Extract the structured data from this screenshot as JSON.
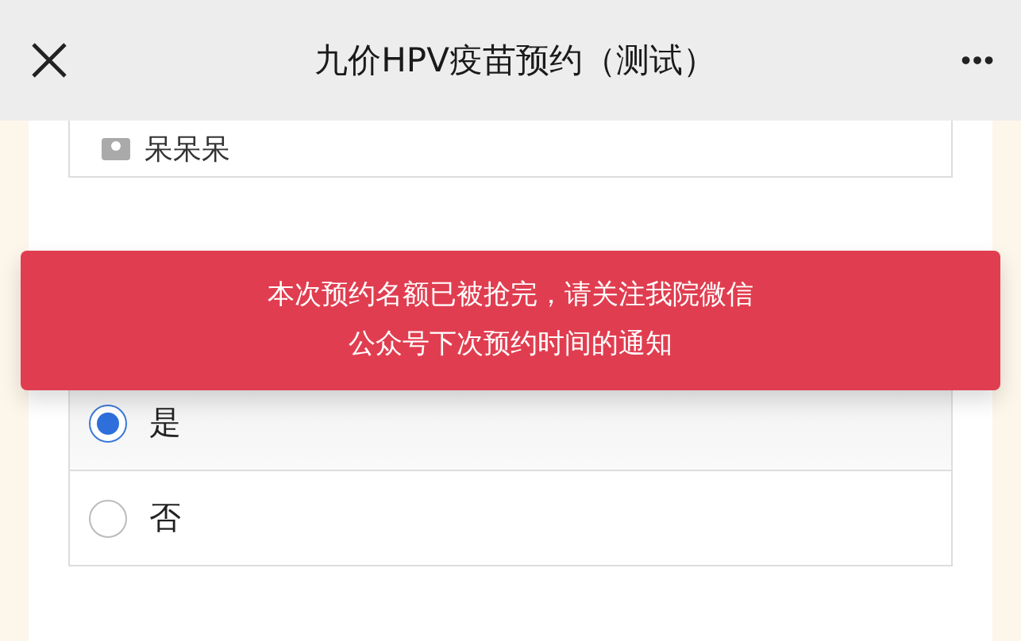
{
  "header": {
    "title": "九价HPV疫苗预约（测试）",
    "more": "•••"
  },
  "name_field": {
    "value": "呆呆呆"
  },
  "options": [
    {
      "label": "是",
      "selected": true
    },
    {
      "label": "否",
      "selected": false
    }
  ],
  "alert": {
    "lines": [
      "本次预约名额已被抢完，请关注我院微信",
      "公众号下次预约时间的通知"
    ]
  }
}
